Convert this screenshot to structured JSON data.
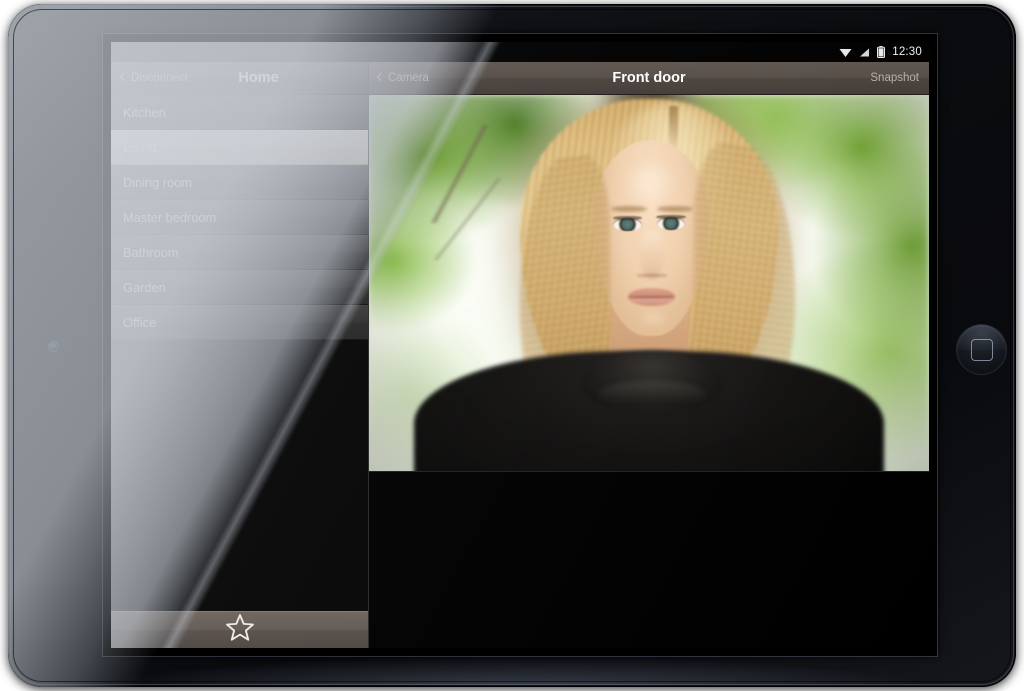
{
  "device": {
    "type": "tablet",
    "home_button_icon": "rounded-square-icon",
    "front_camera_icon": "camera-lens-icon"
  },
  "status_bar": {
    "wifi_icon": "wifi-icon",
    "signal_icon": "cellular-signal-icon",
    "battery_icon": "battery-icon",
    "clock": "12:30"
  },
  "sidebar": {
    "back_label": "Disconnect",
    "back_icon": "chevron-left-icon",
    "title": "Home",
    "items": [
      {
        "label": "Kitchen",
        "selected": false
      },
      {
        "label": "Living",
        "selected": true
      },
      {
        "label": "Dining room",
        "selected": false
      },
      {
        "label": "Master bedroom",
        "selected": false
      },
      {
        "label": "Bathroom",
        "selected": false
      },
      {
        "label": "Garden",
        "selected": false
      },
      {
        "label": "Office",
        "selected": false
      }
    ],
    "toolbar": {
      "favorite_icon": "star-outline-icon"
    }
  },
  "detail": {
    "back_label": "Camera",
    "back_icon": "chevron-left-icon",
    "title": "Front door",
    "action_label": "Snapshot",
    "video": {
      "description": "Live camera feed: portrait of a blonde woman in a black turtleneck outdoors with blurred green foliage"
    }
  },
  "colors": {
    "selected_row": "#c8bfb4",
    "nav_bar": "#554d47",
    "row_bg": "#2f2f2f",
    "screen_bg": "#000000",
    "text_primary": "#ffffff",
    "text_secondary": "#b6afa9"
  }
}
